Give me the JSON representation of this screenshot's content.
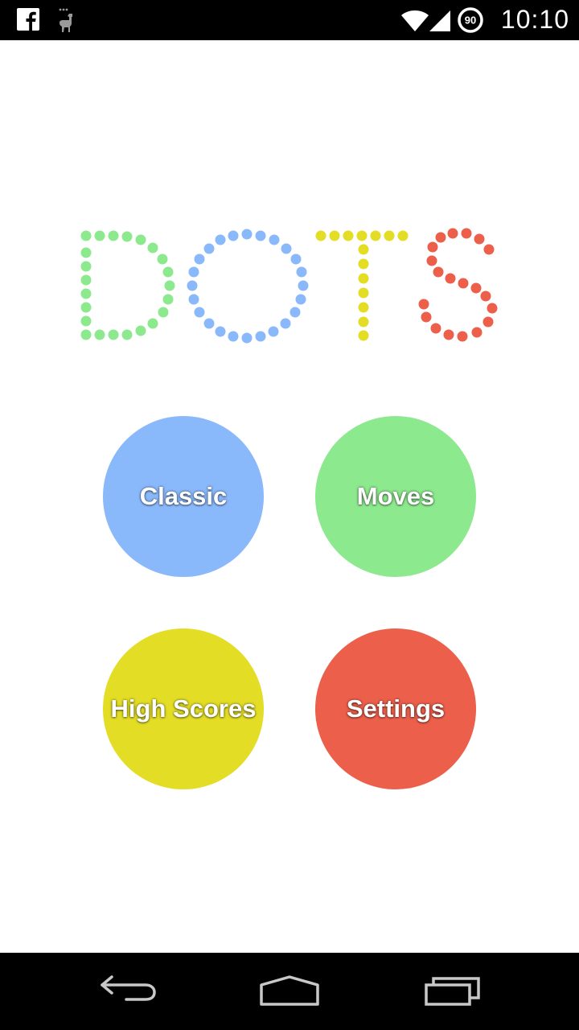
{
  "status_bar": {
    "time": "10:10",
    "battery_level": "90",
    "icons": [
      "facebook-icon",
      "llama-icon",
      "wifi-icon",
      "signal-icon",
      "battery-icon"
    ]
  },
  "logo": {
    "text": "DOTS",
    "colors": {
      "D": "#8de98d",
      "O": "#8ab9fb",
      "T": "#e3dd25",
      "S": "#ec5f4b"
    }
  },
  "menu": {
    "classic": {
      "label": "Classic",
      "color": "#8ab9fb"
    },
    "moves": {
      "label": "Moves",
      "color": "#8de98d"
    },
    "high_scores": {
      "label": "High Scores",
      "color": "#e3dd25"
    },
    "settings": {
      "label": "Settings",
      "color": "#ec5f4b"
    }
  },
  "nav_bar": {
    "icons": [
      "back-icon",
      "home-icon",
      "recents-icon"
    ]
  }
}
